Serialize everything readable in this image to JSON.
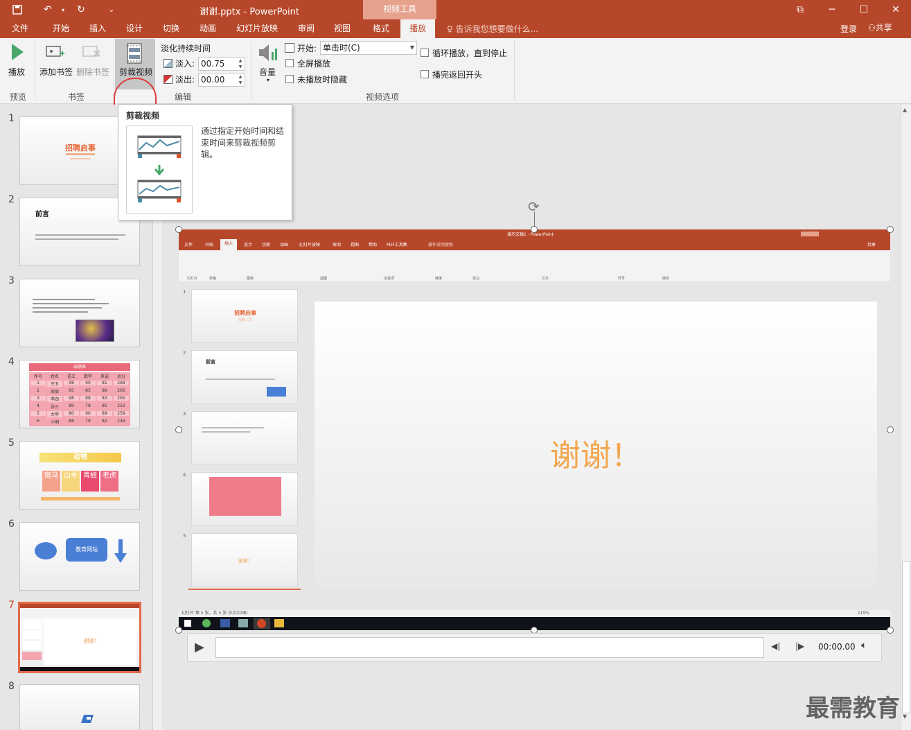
{
  "window": {
    "title": "谢谢.pptx - PowerPoint",
    "context_group": "视频工具",
    "minimize_label": "─",
    "maximize_label": "☐",
    "close_label": "✕",
    "restore_label": "⧉"
  },
  "quick_access": {
    "save_icon": "save-icon",
    "undo_icon": "undo-icon",
    "redo_icon": "redo-icon"
  },
  "tabs": [
    "文件",
    "开始",
    "插入",
    "设计",
    "切换",
    "动画",
    "幻灯片放映",
    "审阅",
    "视图",
    "格式",
    "播放"
  ],
  "active_tab": "播放",
  "tell_me": "告诉我您想要做什么...",
  "account": {
    "login": "登录",
    "share": "共享"
  },
  "ribbon": {
    "play_label": "播放",
    "add_bookmark": "添加书签",
    "remove_bookmark": "删除书签",
    "trim_video": "剪裁视频",
    "fade_duration": "淡化持续时间",
    "fade_in_label": "淡入:",
    "fade_in_value": "00.75",
    "fade_out_label": "淡出:",
    "fade_out_value": "00.00",
    "volume_label": "音量",
    "start_label": "开始:",
    "start_value": "单击时(C)",
    "fullscreen": "全屏播放",
    "hide_not_playing": "未播放时隐藏",
    "loop": "循环播放，直到停止",
    "rewind": "播完返回开头",
    "groups": {
      "preview": "预览",
      "bookmarks": "书签",
      "editing": "编辑",
      "video_options": "视频选项"
    }
  },
  "tooltip": {
    "title": "剪裁视频",
    "description": "通过指定开始时间和结束时间来剪裁视频剪辑。"
  },
  "slides": [
    {
      "num": "1",
      "title": "招聘启事"
    },
    {
      "num": "2",
      "title": "前言"
    },
    {
      "num": "3",
      "title": ""
    },
    {
      "num": "4",
      "title": "成绩表",
      "headers": [
        "序号",
        "姓名",
        "语文",
        "数学",
        "英语",
        "总分"
      ],
      "rows": [
        [
          "1",
          "王五",
          "98",
          "90",
          "81",
          "269"
        ],
        [
          "2",
          "周周",
          "95",
          "85",
          "86",
          "266"
        ],
        [
          "3",
          "李四",
          "98",
          "88",
          "83",
          "265"
        ],
        [
          "4",
          "张三",
          "89",
          "78",
          "85",
          "252"
        ],
        [
          "5",
          "大甲",
          "80",
          "90",
          "89",
          "259"
        ],
        [
          "6",
          "小明",
          "88",
          "79",
          "82",
          "249"
        ]
      ]
    },
    {
      "num": "5",
      "title": "动物",
      "cells": [
        "斑马",
        "山羊",
        "青蛙",
        "老虎"
      ]
    },
    {
      "num": "6",
      "title": "",
      "button": "教育网站"
    },
    {
      "num": "7",
      "title": "谢谢!"
    },
    {
      "num": "8",
      "title": ""
    }
  ],
  "video": {
    "inner_app_title": "演示文稿1 - PowerPoint",
    "inner_tabs": [
      "文件",
      "开始",
      "插入",
      "设计",
      "切换",
      "动画",
      "幻灯片放映",
      "审阅",
      "视图",
      "帮助",
      "PDF工具集"
    ],
    "inner_tell_me": "操作说明搜索",
    "inner_share": "共享",
    "inner_groups": [
      "幻灯片",
      "表格",
      "图像",
      "插图",
      "加载项",
      "链接",
      "批注",
      "文本",
      "符号",
      "媒体"
    ],
    "inner_slide_text": "谢谢！",
    "inner_thumbs": [
      {
        "num": "1",
        "title": "招聘启事",
        "subtitle": "招聘人员"
      },
      {
        "num": "2",
        "title": "前言"
      },
      {
        "num": "3",
        "title": ""
      },
      {
        "num": "4",
        "title": ""
      },
      {
        "num": "5",
        "title": "谢谢！"
      }
    ],
    "inner_status": "幻灯片 第 5 张，共 5 张    中文(中国)",
    "inner_zoom": "119%"
  },
  "player": {
    "time": "00:00.00"
  },
  "watermark": "最需教育",
  "colors": {
    "accent": "#b7472a",
    "highlight": "#e03c3c",
    "selected_thumb": "#e26a4a"
  }
}
